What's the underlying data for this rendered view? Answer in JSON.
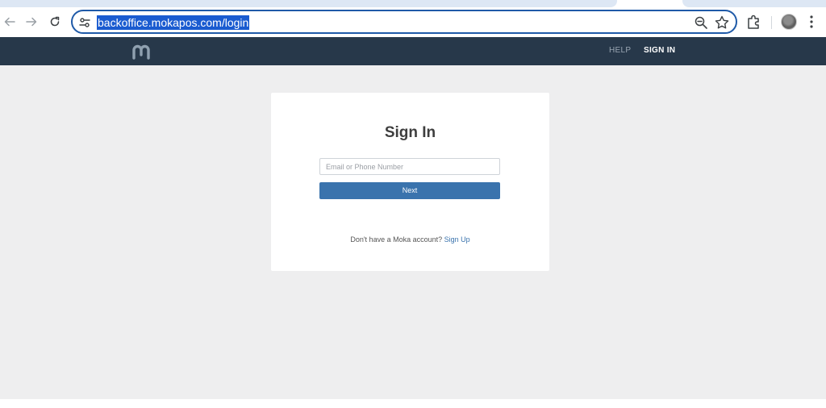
{
  "browser": {
    "url": "backoffice.mokapos.com/login",
    "icons": {
      "back": "back-arrow-icon",
      "forward": "forward-arrow-icon",
      "reload": "reload-icon",
      "site_settings": "tune-icon",
      "zoom": "zoom-out-icon",
      "bookmark": "star-icon",
      "extensions": "puzzle-icon",
      "profile": "avatar",
      "menu": "kebab-menu-icon"
    },
    "colors": {
      "omnibox_border": "#1f5aa8",
      "url_highlight": "#1a5bd0"
    }
  },
  "header": {
    "logo": "moka-logo",
    "nav": {
      "help": "HELP",
      "sign_in": "SIGN IN"
    },
    "colors": {
      "background": "#27384a"
    }
  },
  "signin": {
    "title": "Sign In",
    "email_placeholder": "Email or Phone Number",
    "email_value": "",
    "next_label": "Next",
    "no_account_text": "Don't have a Moka account?",
    "signup_link": "Sign Up",
    "colors": {
      "primary": "#3a73ad",
      "page_bg": "#eeeeef"
    }
  }
}
